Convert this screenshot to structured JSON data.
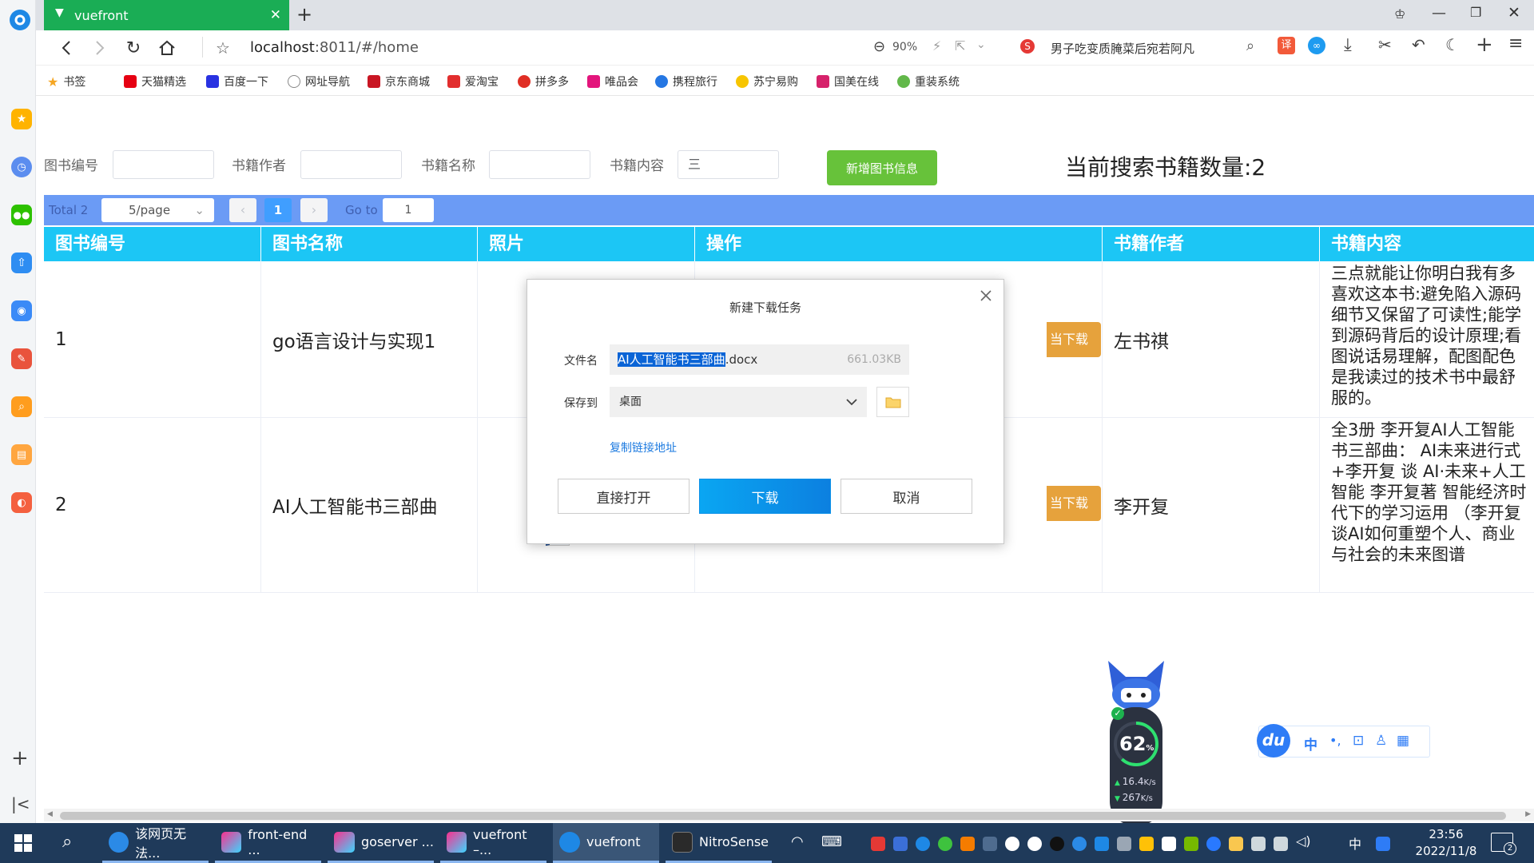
{
  "browser": {
    "tab_title": "vuefront",
    "new_tab": "+",
    "url_host": "localhost",
    "url_rest": ":8011/#/home",
    "zoom": "90%",
    "hot_search": "男子吃变质腌菜后宛若阿凡",
    "translate": "译"
  },
  "bookmarks": [
    "书签",
    "天猫精选",
    "百度一下",
    "网址导航",
    "京东商城",
    "爱淘宝",
    "拼多多",
    "唯品会",
    "携程旅行",
    "苏宁易购",
    "国美在线",
    "重装系统"
  ],
  "search_form": {
    "label_id": "图书编号",
    "label_author": "书籍作者",
    "label_name": "书籍名称",
    "label_content": "书籍内容",
    "content_value": "三",
    "add_button": "新增图书信息",
    "count_label": "当前搜索书籍数量:2"
  },
  "pagination": {
    "total": "Total 2",
    "page_size": "5/page",
    "prev": "‹",
    "current_page": "1",
    "next": "›",
    "goto_label": "Go to",
    "goto_value": "1"
  },
  "table": {
    "headers": [
      "图书编号",
      "图书名称",
      "照片",
      "操作",
      "书籍作者",
      "书籍内容"
    ],
    "rows": [
      {
        "id": "1",
        "name": "go语言设计与实现1",
        "action": "当下载",
        "author": "左书祺",
        "content": "三点就能让你明白我有多喜欢这本书:避免陷入源码细节又保留了可读性;能学到源码背后的设计原理;看图说话易理解，配图配色是我读过的技术书中最舒服的。"
      },
      {
        "id": "2",
        "name": "AI人工智能书三部曲",
        "action": "当下载",
        "author": "李开复",
        "content": "全3册 李开复AI人工智能书三部曲： AI未来进行式+李开复 谈 AI·未来+人工智能 李开复著 智能经济时代下的学习运用 （李开复谈AI如何重塑个人、商业与社会的未来图谱"
      }
    ]
  },
  "download_dialog": {
    "title": "新建下载任务",
    "filename_label": "文件名",
    "filename_selected": "AI人工智能书三部曲",
    "filename_ext": ".docx",
    "file_size": "661.03KB",
    "save_label": "保存到",
    "save_location": "桌面",
    "copy_link": "复制链接地址",
    "open_button": "直接打开",
    "download_button": "下载",
    "cancel_button": "取消"
  },
  "speed_widget": {
    "percent": "62",
    "unit": "%",
    "upload": "16.4",
    "download": "267",
    "rate_unit": "K/s"
  },
  "ime_toolbar": {
    "brand": "du",
    "mode": "中"
  },
  "taskbar": {
    "items": [
      {
        "label": "该网页无法..."
      },
      {
        "label": "front-end ..."
      },
      {
        "label": "goserver ..."
      },
      {
        "label": "vuefront –..."
      },
      {
        "label": "vuefront"
      },
      {
        "label": "NitroSense"
      }
    ],
    "ime_mode": "中",
    "time": "23:56",
    "date": "2022/11/8",
    "notifications": "2"
  },
  "colors": {
    "tab_active": "#1aad55",
    "pagination_bar": "#6b9bf5",
    "table_header": "#1cc6f5",
    "add_button": "#67c23a",
    "download_button": "#0c8ce9",
    "row_action": "#e6a23c",
    "taskbar": "#1f3a5a"
  }
}
